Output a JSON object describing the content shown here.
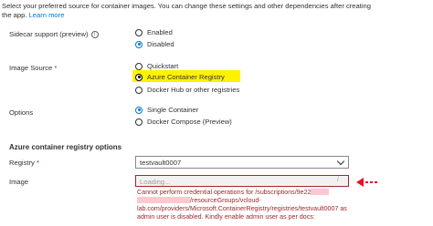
{
  "intro": {
    "line1": "Select your preferred source for container images. You can change these settings and other dependencies after creating",
    "line2_prefix": "the app.",
    "learn_more": "Learn more"
  },
  "sidecar": {
    "label": "Sidecar support (preview)",
    "options": [
      "Enabled",
      "Disabled"
    ],
    "selected": "Disabled"
  },
  "image_source": {
    "label": "Image Source",
    "required_mark": "*",
    "options": [
      "Quickstart",
      "Azure Container Registry",
      "Docker Hub or other registries"
    ],
    "selected": "Azure Container Registry",
    "highlight_color": "#fff200"
  },
  "options": {
    "label": "Options",
    "choices": [
      "Single Container",
      "Docker Compose (Preview)"
    ],
    "selected": "Single Container"
  },
  "acr_section": {
    "title": "Azure container registry options",
    "registry_label": "Registry",
    "registry_required": "*",
    "registry_value": "testvault0007",
    "image_label": "Image",
    "image_placeholder": "Loading...",
    "image_slash": "/",
    "error_line1": "Cannot perform credential operations for /subscriptions/9e22",
    "error_line2": "/resourceGroups/vcloud-",
    "error_line3": "lab.com/providers/Microsoft.ContainerRegistry/registries/testvault0007 as",
    "error_line4": "admin user is disabled. Kindly enable admin user as per docs:"
  },
  "colors": {
    "accent": "#0078d4",
    "error": "#a4262c",
    "annotation_arrow": "#e81123"
  }
}
